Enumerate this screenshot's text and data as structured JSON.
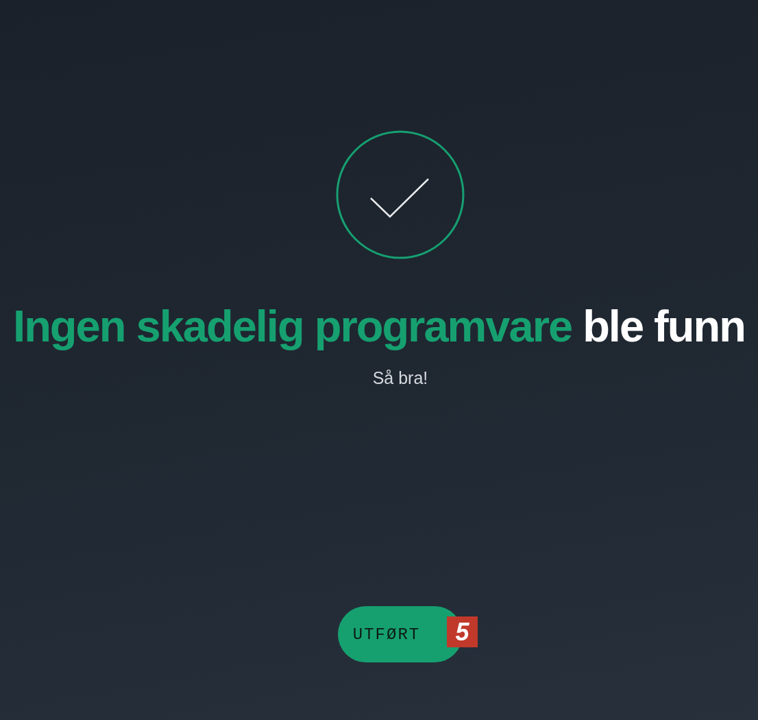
{
  "status_icon": {
    "kind": "success"
  },
  "heading": {
    "highlight": "Ingen skadelig programvare",
    "rest": "ble funn"
  },
  "subtitle": "Så bra!",
  "button": {
    "label": "UTFØRT",
    "callout": "5"
  }
}
